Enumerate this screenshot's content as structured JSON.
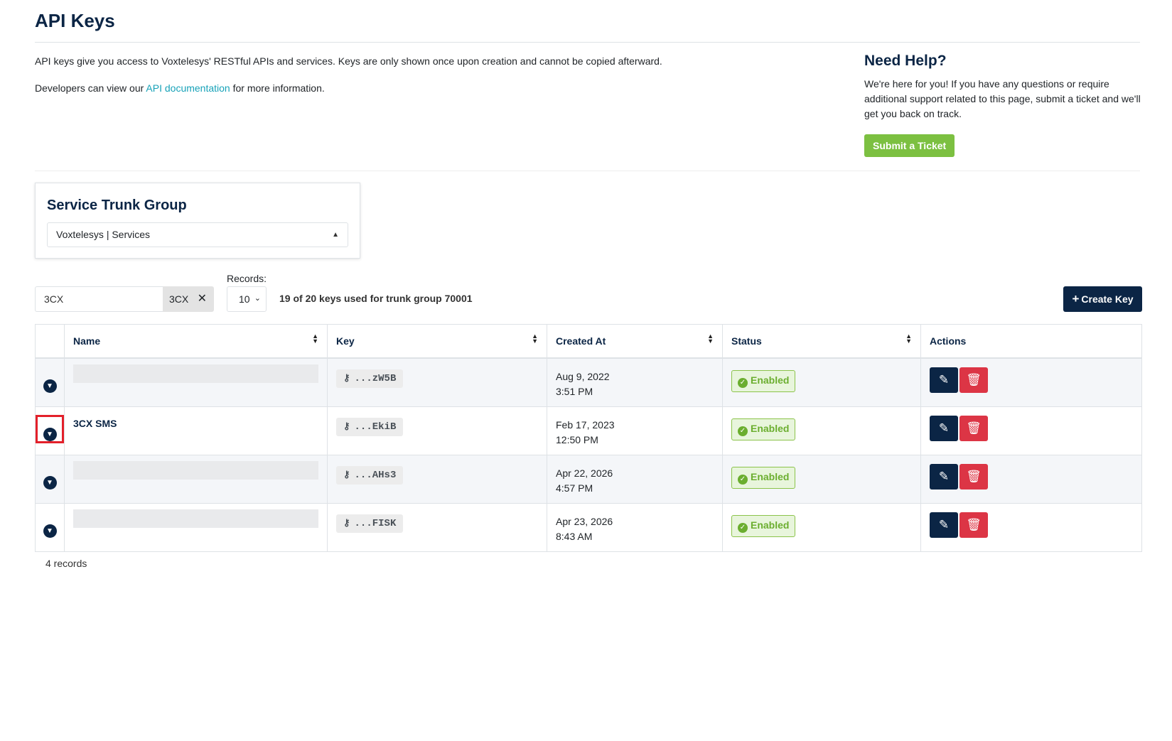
{
  "header": {
    "title": "API Keys"
  },
  "intro": {
    "line1": "API keys give you access to Voxtelesys' RESTful APIs and services. Keys are only shown once upon creation and cannot be copied afterward.",
    "line2_prefix": "Developers can view our ",
    "line2_link": "API documentation",
    "line2_suffix": " for more information."
  },
  "help": {
    "title": "Need Help?",
    "text": "We're here for you! If you have any questions or require additional support related to this page, submit a ticket and we'll get you back on track.",
    "button": "Submit a Ticket"
  },
  "trunk_group": {
    "title": "Service Trunk Group",
    "selected": "Voxtelesys | Services"
  },
  "filters": {
    "search_value": "3CX",
    "chip_label": "3CX",
    "records_label": "Records:",
    "records_value": "10",
    "usage_text": "19 of 20 keys used for trunk group 70001",
    "create_button": "Create Key"
  },
  "table": {
    "columns": [
      "Name",
      "Key",
      "Created At",
      "Status",
      "Actions"
    ],
    "rows": [
      {
        "name": "",
        "key": "...zW5B",
        "date": "Aug 9, 2022",
        "time": "3:51 PM",
        "status": "Enabled"
      },
      {
        "name": "3CX SMS",
        "key": "...EkiB",
        "date": "Feb 17, 2023",
        "time": "12:50 PM",
        "status": "Enabled"
      },
      {
        "name": "",
        "key": "...AHs3",
        "date": "Apr 22, 2026",
        "time": "4:57 PM",
        "status": "Enabled"
      },
      {
        "name": "",
        "key": "...FISK",
        "date": "Apr 23, 2026",
        "time": "8:43 AM",
        "status": "Enabled"
      }
    ],
    "footer": "4 records"
  },
  "colors": {
    "brand_navy": "#0b2545",
    "success_green": "#7cc041",
    "danger_red": "#dc3545",
    "link_teal": "#17a2b8",
    "highlight_red": "#e3202a"
  },
  "icons": {
    "sort": "sort-icon",
    "expand": "chevron-down-icon",
    "key": "key-icon",
    "check": "check-circle-icon",
    "edit": "pencil-icon",
    "delete": "trash-icon",
    "clear": "close-icon"
  }
}
